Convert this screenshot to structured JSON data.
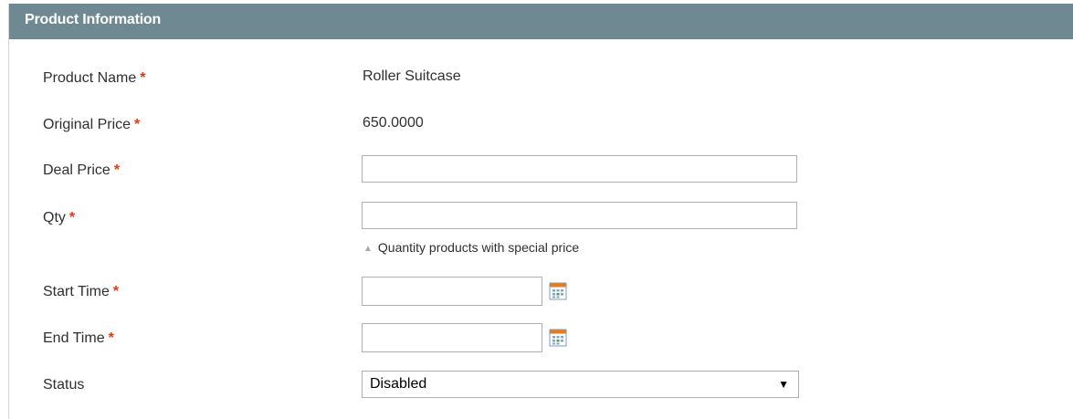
{
  "panel": {
    "title": "Product Information"
  },
  "fields": {
    "product_name": {
      "label": "Product Name",
      "required": "*",
      "value": "Roller Suitcase"
    },
    "original_price": {
      "label": "Original Price",
      "required": "*",
      "value": "650.0000"
    },
    "deal_price": {
      "label": "Deal Price",
      "required": "*",
      "value": ""
    },
    "qty": {
      "label": "Qty",
      "required": "*",
      "value": "",
      "note": "Quantity products with special price"
    },
    "start_time": {
      "label": "Start Time",
      "required": "*",
      "value": ""
    },
    "end_time": {
      "label": "End Time",
      "required": "*",
      "value": ""
    },
    "status": {
      "label": "Status",
      "selected": "Disabled"
    }
  },
  "icons": {
    "calendar": "calendar-icon",
    "note_arrow": "triangle-up-icon",
    "select_arrow": "triangle-down-icon"
  },
  "colors": {
    "header_bg": "#6f8992",
    "required": "#eb340a",
    "border": "#b0b0b0"
  }
}
